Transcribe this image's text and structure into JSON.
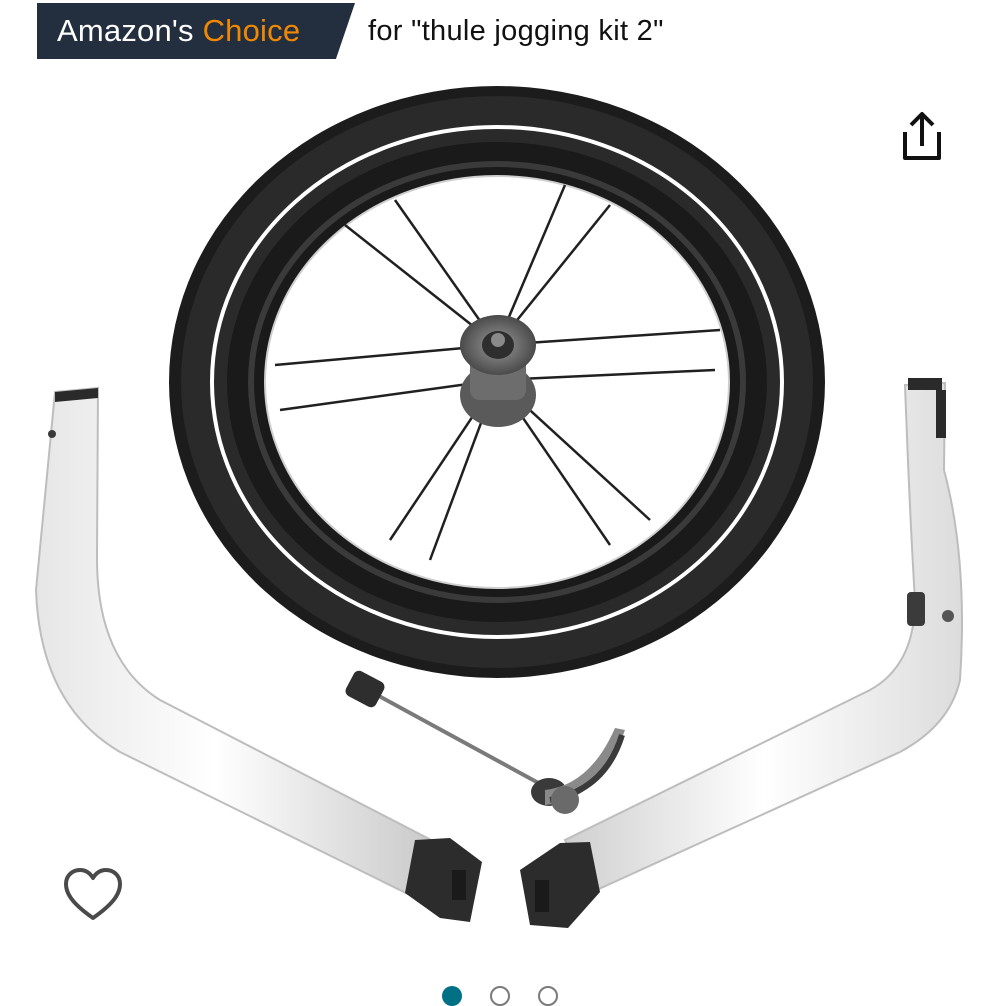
{
  "badge": {
    "prefix": "Amazon's",
    "highlight": "Choice",
    "query": "for \"thule jogging kit 2\""
  },
  "icons": {
    "share": "share-icon",
    "wishlist": "heart-outline-icon"
  },
  "carousel": {
    "total": 3,
    "active_index": 0
  },
  "colors": {
    "badge_bg": "#232f3e",
    "badge_accent": "#f08804",
    "carousel_active": "#007185"
  }
}
